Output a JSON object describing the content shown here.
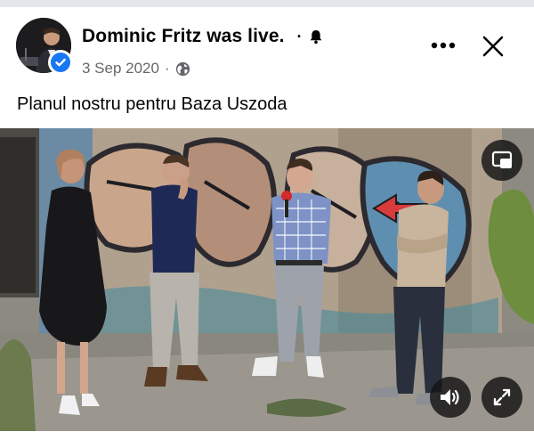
{
  "post": {
    "author_name": "Dominic Fritz was live.",
    "separator": "·",
    "date": "3 Sep 2020",
    "meta_separator": "·",
    "text": "Planul nostru pentru Baza Uszoda"
  },
  "icons": {
    "avatar": "avatar",
    "verified": "verified-badge-icon",
    "bell": "bell-icon",
    "audience": "globe-icon",
    "more": "more-horizontal-icon",
    "close": "close-icon",
    "pip": "picture-in-picture-icon",
    "volume": "volume-icon",
    "fullscreen": "fullscreen-icon"
  },
  "colors": {
    "verified_blue": "#1877f2",
    "meta_gray": "#65676b",
    "control_bg": "#141414"
  }
}
